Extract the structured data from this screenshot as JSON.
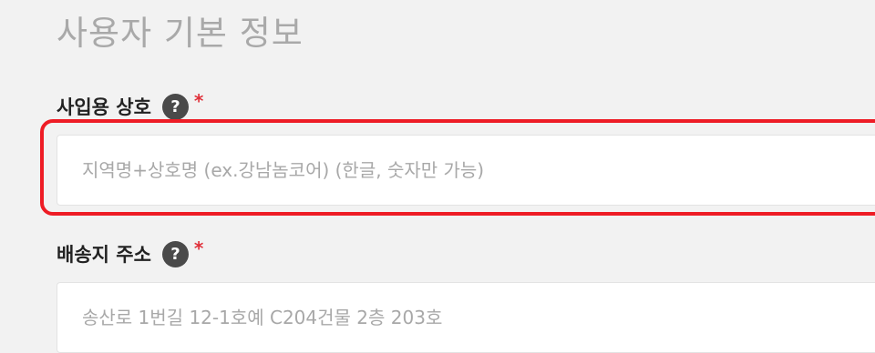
{
  "section": {
    "title": "사용자 기본 정보"
  },
  "fields": [
    {
      "label": "사입용 상호",
      "help_icon": "?",
      "required_mark": "*",
      "placeholder": "지역명+상호명 (ex.강남놈코어) (한글, 숫자만 가능)",
      "value": "",
      "highlighted": true,
      "highlight_color": "#ee1c25"
    },
    {
      "label": "배송지 주소",
      "help_icon": "?",
      "required_mark": "*",
      "placeholder": "송산로 1번길 12-1호예 C204건물 2층 203호",
      "value": ""
    }
  ],
  "colors": {
    "background": "#f2f2f2",
    "required": "#e0303a",
    "help_icon_bg": "#4a4a4a"
  }
}
